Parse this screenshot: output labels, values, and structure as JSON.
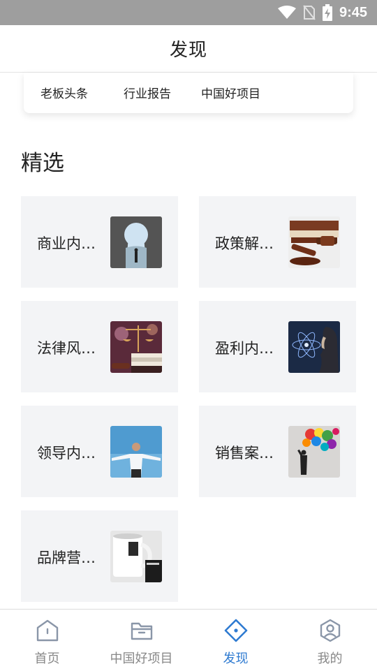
{
  "status_bar": {
    "time": "9:45",
    "icons": [
      "wifi-icon",
      "no-sim-icon",
      "battery-charging-icon"
    ]
  },
  "app_bar": {
    "title": "发现"
  },
  "categories": [
    {
      "label": "老板头条"
    },
    {
      "label": "行业报告"
    },
    {
      "label": "中国好项目"
    }
  ],
  "section": {
    "title": "精选"
  },
  "featured": [
    {
      "label": "商业内…",
      "thumb_icon": "keyhole-sky-thumbnail"
    },
    {
      "label": "政策解…",
      "thumb_icon": "gavel-books-thumbnail"
    },
    {
      "label": "法律风…",
      "thumb_icon": "scales-of-justice-thumbnail"
    },
    {
      "label": "盈利内…",
      "thumb_icon": "atom-thinker-thumbnail"
    },
    {
      "label": "领导内…",
      "thumb_icon": "arms-spread-businessman-thumbnail"
    },
    {
      "label": "销售案…",
      "thumb_icon": "paint-splash-thumbnail"
    },
    {
      "label": "品牌营…",
      "thumb_icon": "coffee-mug-thumbnail"
    }
  ],
  "bottom_nav": {
    "items": [
      {
        "label": "首页",
        "icon": "home-icon"
      },
      {
        "label": "中国好项目",
        "icon": "folder-icon"
      },
      {
        "label": "发现",
        "icon": "compass-diamond-icon"
      },
      {
        "label": "我的",
        "icon": "profile-icon"
      }
    ],
    "active_index": 2
  },
  "colors": {
    "accent": "#2f7bd1",
    "inactive": "#888888",
    "card_bg": "#f3f4f6",
    "status_bar": "#9e9e9e"
  }
}
